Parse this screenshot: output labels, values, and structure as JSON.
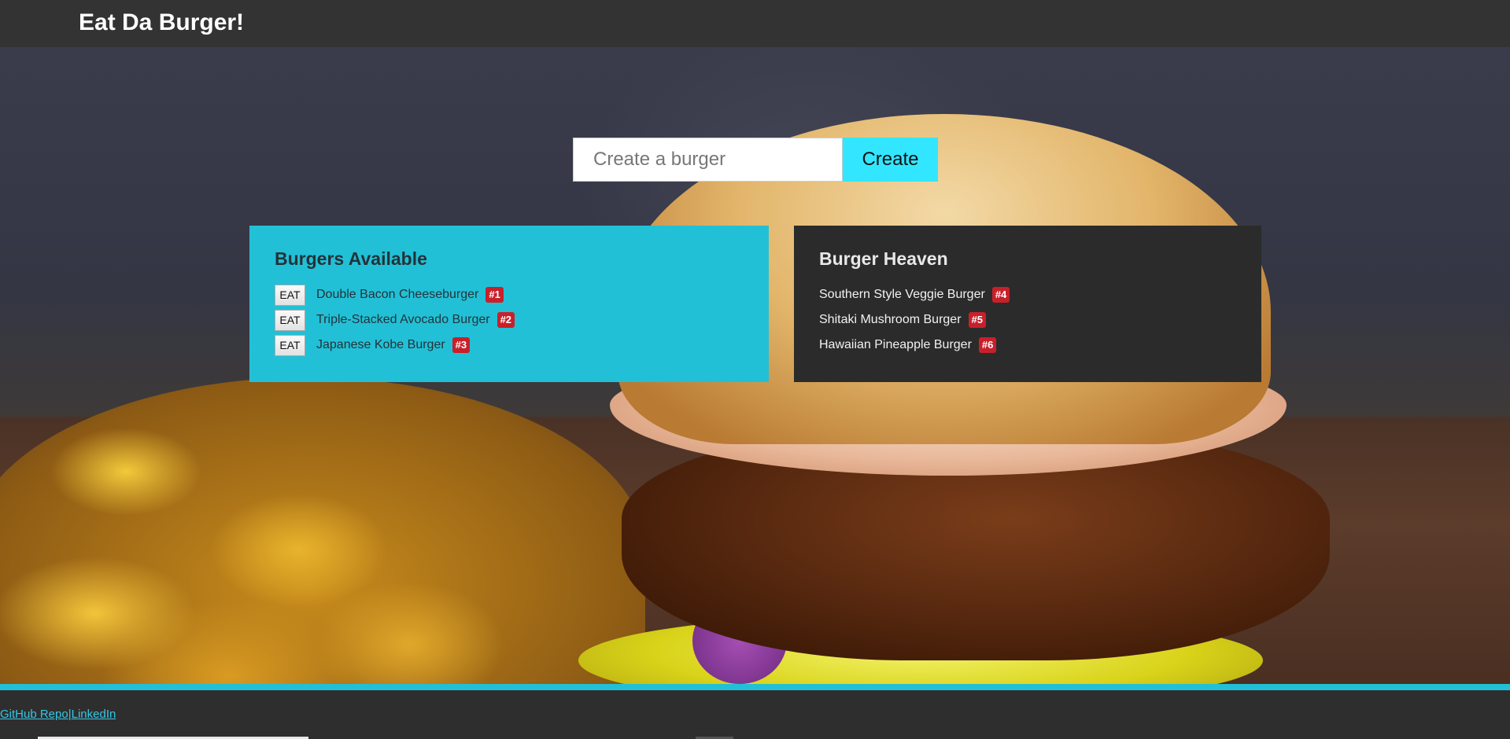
{
  "navbar": {
    "brand": "Eat Da Burger!"
  },
  "form": {
    "placeholder": "Create a burger",
    "value": "",
    "create_label": "Create"
  },
  "available": {
    "title": "Burgers Available",
    "eat_label": "EAT",
    "items": [
      {
        "name": "Double Bacon Cheeseburger",
        "badge": "#1"
      },
      {
        "name": "Triple-Stacked Avocado Burger",
        "badge": "#2"
      },
      {
        "name": "Japanese Kobe Burger",
        "badge": "#3"
      }
    ]
  },
  "heaven": {
    "title": "Burger Heaven",
    "items": [
      {
        "name": "Southern Style Veggie Burger",
        "badge": "#4"
      },
      {
        "name": "Shitaki Mushroom Burger",
        "badge": "#5"
      },
      {
        "name": "Hawaiian Pineapple Burger",
        "badge": "#6"
      }
    ]
  },
  "footer": {
    "github_label": "GitHub Repo",
    "separator": "|",
    "linkedin_label": "LinkedIn"
  },
  "colors": {
    "accent": "#22c0d6",
    "create_button": "#33e6ff",
    "badge": "#c8202a",
    "dark_panel": "#2b2b2b",
    "navbar": "#333333"
  }
}
